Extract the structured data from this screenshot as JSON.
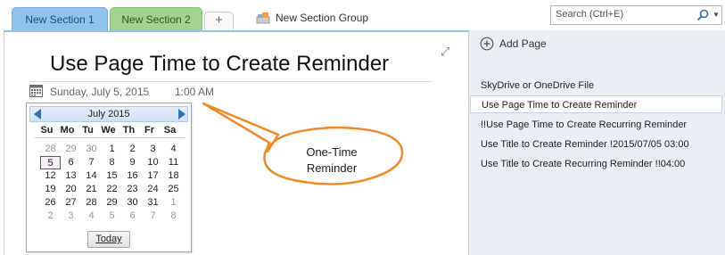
{
  "tabs": [
    {
      "label": "New Section 1",
      "color": "#8ec3ea"
    },
    {
      "label": "New Section 2",
      "color": "#9fd38f"
    },
    {
      "label": "+"
    }
  ],
  "section_group": {
    "label": "New Section Group",
    "icon": "section-group-icon"
  },
  "search": {
    "placeholder": "Search (Ctrl+E)",
    "icon": "search-icon"
  },
  "page": {
    "title": "Use Page Time to Create Reminder",
    "date": "Sunday, July 5, 2015",
    "time": "1:00 AM"
  },
  "calendar": {
    "month_label": "July 2015",
    "day_headers": [
      "Su",
      "Mo",
      "Tu",
      "We",
      "Th",
      "Fr",
      "Sa"
    ],
    "weeks": [
      [
        "28",
        "29",
        "30",
        "1",
        "2",
        "3",
        "4"
      ],
      [
        "5",
        "6",
        "7",
        "8",
        "9",
        "10",
        "11"
      ],
      [
        "12",
        "13",
        "14",
        "15",
        "16",
        "17",
        "18"
      ],
      [
        "19",
        "20",
        "21",
        "22",
        "23",
        "24",
        "25"
      ],
      [
        "26",
        "27",
        "28",
        "29",
        "30",
        "31",
        "1"
      ],
      [
        "2",
        "3",
        "4",
        "5",
        "6",
        "7",
        "8"
      ]
    ],
    "selected_day": "5",
    "today_label": "Today"
  },
  "callout": {
    "line1": "One-Time",
    "line2": "Reminder",
    "border_color": "#f08a24"
  },
  "page_list": {
    "add_label": "Add Page",
    "items": [
      {
        "label": "SkyDrive or OneDrive File",
        "active": false
      },
      {
        "label": "Use Page Time to Create Reminder",
        "active": true
      },
      {
        "label": "!!Use Page Time to Create Recurring Reminder",
        "active": false
      },
      {
        "label": "Use Title to Create Reminder !2015/07/05 03:00",
        "active": false
      },
      {
        "label": "Use Title to Create Recurring Reminder !!04:00",
        "active": false
      }
    ]
  }
}
